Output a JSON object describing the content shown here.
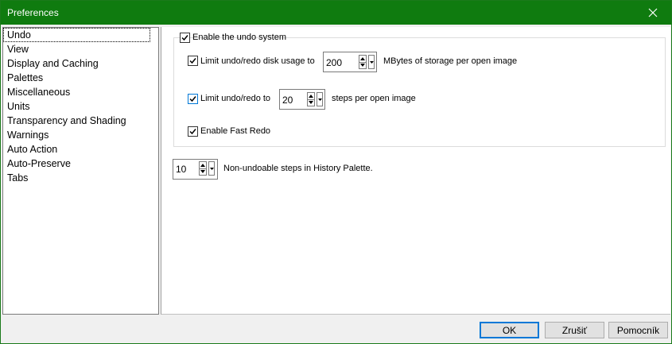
{
  "window": {
    "title": "Preferences"
  },
  "sidebar": {
    "items": [
      {
        "label": "Undo",
        "selected": true
      },
      {
        "label": "View"
      },
      {
        "label": "Display and Caching"
      },
      {
        "label": "Palettes"
      },
      {
        "label": "Miscellaneous"
      },
      {
        "label": "Units"
      },
      {
        "label": "Transparency and Shading"
      },
      {
        "label": "Warnings"
      },
      {
        "label": "Auto Action"
      },
      {
        "label": "Auto-Preserve"
      },
      {
        "label": "Tabs"
      }
    ]
  },
  "undo": {
    "enable_undo": {
      "label": "Enable the undo system",
      "checked": true
    },
    "limit_disk": {
      "label": "Limit undo/redo disk usage to",
      "checked": true,
      "value": "200",
      "suffix": "MBytes of storage per open image"
    },
    "limit_steps": {
      "label": "Limit undo/redo to",
      "checked": true,
      "value": "20",
      "suffix": "steps per open image"
    },
    "fast_redo": {
      "label": "Enable Fast Redo",
      "checked": true
    },
    "non_undoable": {
      "value": "10",
      "suffix": "Non-undoable steps in History Palette."
    }
  },
  "buttons": {
    "ok": "OK",
    "cancel": "Zrušiť",
    "help": "Pomocník"
  },
  "colors": {
    "titlebar": "#0f7b0f",
    "accent": "#0078d7"
  },
  "icons": {
    "close": "close-icon",
    "check": "checkmark-icon",
    "spin_up": "spin-up-icon",
    "spin_down": "spin-down-icon",
    "dropdown": "dropdown-arrow-icon"
  }
}
